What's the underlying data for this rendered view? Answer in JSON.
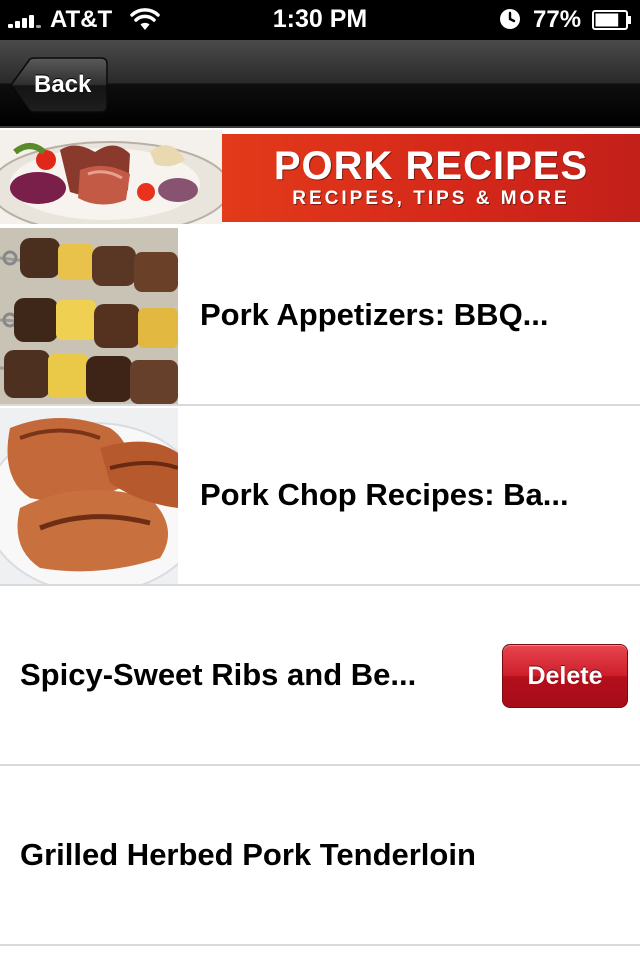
{
  "status_bar": {
    "carrier": "AT&T",
    "time": "1:30 PM",
    "battery_percent": "77%",
    "battery_level": 0.77,
    "icons": [
      "signal-icon",
      "wifi-icon",
      "alarm-icon",
      "battery-icon"
    ]
  },
  "nav_bar": {
    "back_label": "Back"
  },
  "banner": {
    "title": "PORK RECIPES",
    "subtitle": "RECIPES, TIPS & MORE",
    "accent_color": "#d4271a"
  },
  "list": {
    "items": [
      {
        "title": "Pork Appetizers: BBQ...",
        "has_image": true,
        "image": "pork-skewers-photo"
      },
      {
        "title": "Pork Chop Recipes: Ba...",
        "has_image": true,
        "image": "pork-chops-photo"
      },
      {
        "title": "Spicy-Sweet Ribs and Be...",
        "has_image": false,
        "delete_label": "Delete"
      },
      {
        "title": "Grilled Herbed Pork Tenderloin",
        "has_image": false
      }
    ]
  },
  "colors": {
    "delete_red": "#cc1e2a",
    "separator": "#d9d9d9",
    "nav_dark": "#000000"
  }
}
